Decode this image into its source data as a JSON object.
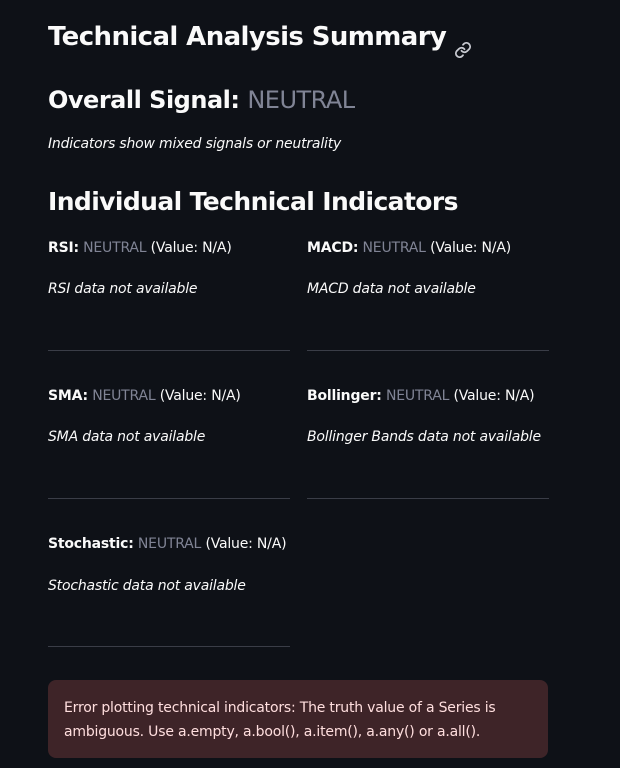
{
  "header": {
    "title": "Technical Analysis Summary",
    "link_icon": "link-icon"
  },
  "overall": {
    "label": "Overall Signal:",
    "signal": "NEUTRAL",
    "description": "Indicators show mixed signals or neutrality"
  },
  "section": {
    "heading": "Individual Technical Indicators"
  },
  "indicators": [
    {
      "name": "RSI:",
      "signal": "NEUTRAL",
      "value_text": "(Value: N/A)",
      "note": "RSI data not available"
    },
    {
      "name": "MACD:",
      "signal": "NEUTRAL",
      "value_text": "(Value: N/A)",
      "note": "MACD data not available"
    },
    {
      "name": "SMA:",
      "signal": "NEUTRAL",
      "value_text": "(Value: N/A)",
      "note": "SMA data not available"
    },
    {
      "name": "Bollinger:",
      "signal": "NEUTRAL",
      "value_text": "(Value: N/A)",
      "note": "Bollinger Bands data not available"
    },
    {
      "name": "Stochastic:",
      "signal": "NEUTRAL",
      "value_text": "(Value: N/A)",
      "note": "Stochastic data not available"
    }
  ],
  "error": {
    "message": "Error plotting technical indicators: The truth value of a Series is ambiguous. Use a.empty, a.bool(), a.item(), a.any() or a.all()."
  },
  "colors": {
    "background": "#0e1117",
    "text": "#fafafa",
    "neutral": "#808495",
    "error_bg": "#3e2428",
    "error_text": "#ffdede"
  }
}
